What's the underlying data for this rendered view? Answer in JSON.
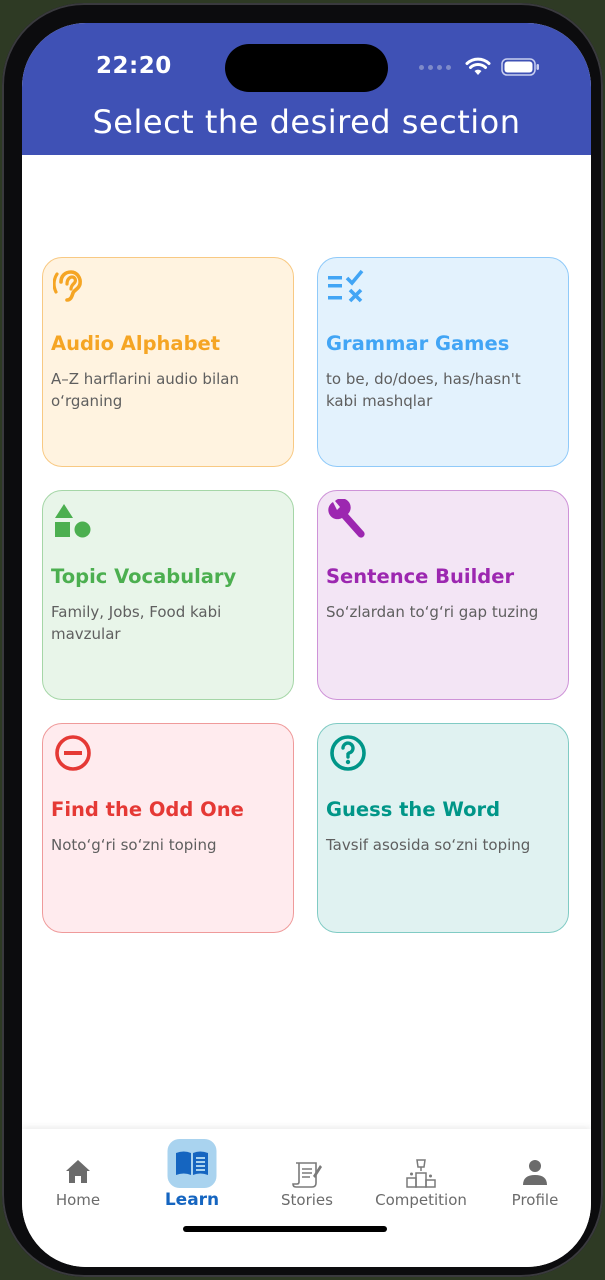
{
  "status_bar": {
    "time": "22:20"
  },
  "header": {
    "title": "Select the desired section"
  },
  "sections": [
    {
      "title": "Audio Alphabet",
      "description": "A–Z harflarini audio bilan o‘rganing",
      "icon": "ear-icon",
      "accent": "#f5a524",
      "bg": "#fff3e0",
      "border": "#f8c983"
    },
    {
      "title": "Grammar Games",
      "description": "to be, do/does, has/hasn't kabi mashqlar",
      "icon": "rule-check-icon",
      "accent": "#42a5f5",
      "bg": "#e3f2fd",
      "border": "#90caf9"
    },
    {
      "title": "Topic Vocabulary",
      "description": "Family, Jobs, Food kabi mavzular",
      "icon": "shapes-icon",
      "accent": "#4caf50",
      "bg": "#e8f5e9",
      "border": "#a5d6a7"
    },
    {
      "title": "Sentence Builder",
      "description": "So‘zlardan to‘g‘ri gap tuzing",
      "icon": "wrench-icon",
      "accent": "#9c27b0",
      "bg": "#f3e5f5",
      "border": "#ce93d8"
    },
    {
      "title": "Find the Odd One",
      "description": "Noto‘g‘ri so‘zni toping",
      "icon": "minus-circle-icon",
      "accent": "#e53935",
      "bg": "#ffebee",
      "border": "#ef9a9a"
    },
    {
      "title": "Guess the Word",
      "description": "Tavsif asosida so‘zni toping",
      "icon": "question-circle-icon",
      "accent": "#009688",
      "bg": "#e0f2f1",
      "border": "#80cbc4"
    }
  ],
  "bottom_nav": {
    "active": "Learn",
    "active_color": "#1565c0",
    "items": [
      {
        "label": "Home",
        "icon": "home-icon"
      },
      {
        "label": "Learn",
        "icon": "book-icon"
      },
      {
        "label": "Stories",
        "icon": "scroll-icon"
      },
      {
        "label": "Competition",
        "icon": "podium-icon"
      },
      {
        "label": "Profile",
        "icon": "person-icon"
      }
    ]
  }
}
